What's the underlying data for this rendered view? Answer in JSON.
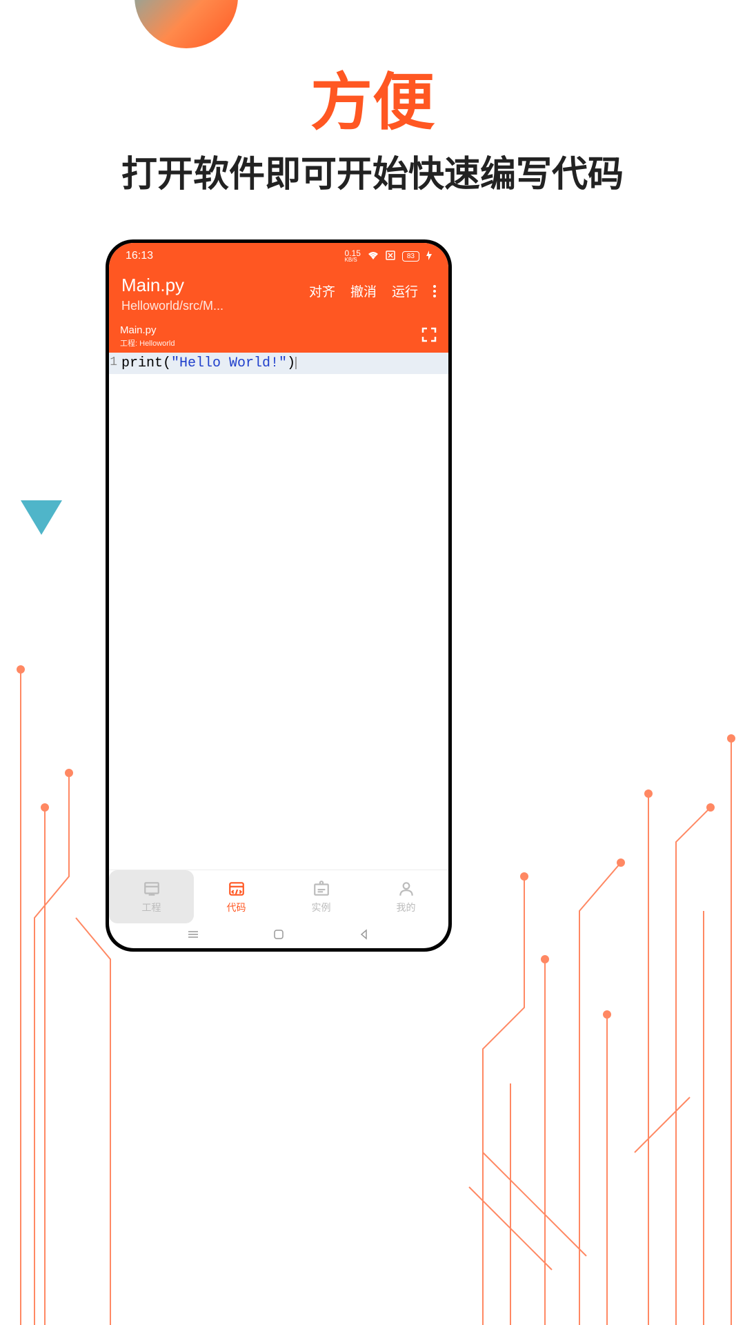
{
  "promo": {
    "title": "方便",
    "subtitle": "打开软件即可开始快速编写代码"
  },
  "status": {
    "time": "16:13",
    "speed": "0.15",
    "speed_unit": "KB/S",
    "battery": "83"
  },
  "header": {
    "title": "Main.py",
    "path": "Helloworld/src/M...",
    "actions": {
      "align": "对齐",
      "undo": "撤消",
      "run": "运行"
    }
  },
  "tab": {
    "filename": "Main.py",
    "project_label": "工程:",
    "project_name": "Helloworld"
  },
  "code": {
    "lines": [
      {
        "num": "1",
        "func": "print",
        "paren_open": "(",
        "string": "\"Hello World!\"",
        "paren_close": ")"
      }
    ]
  },
  "nav": {
    "items": [
      {
        "label": "工程",
        "icon": "project"
      },
      {
        "label": "代码",
        "icon": "code"
      },
      {
        "label": "实例",
        "icon": "example"
      },
      {
        "label": "我的",
        "icon": "profile"
      }
    ]
  }
}
